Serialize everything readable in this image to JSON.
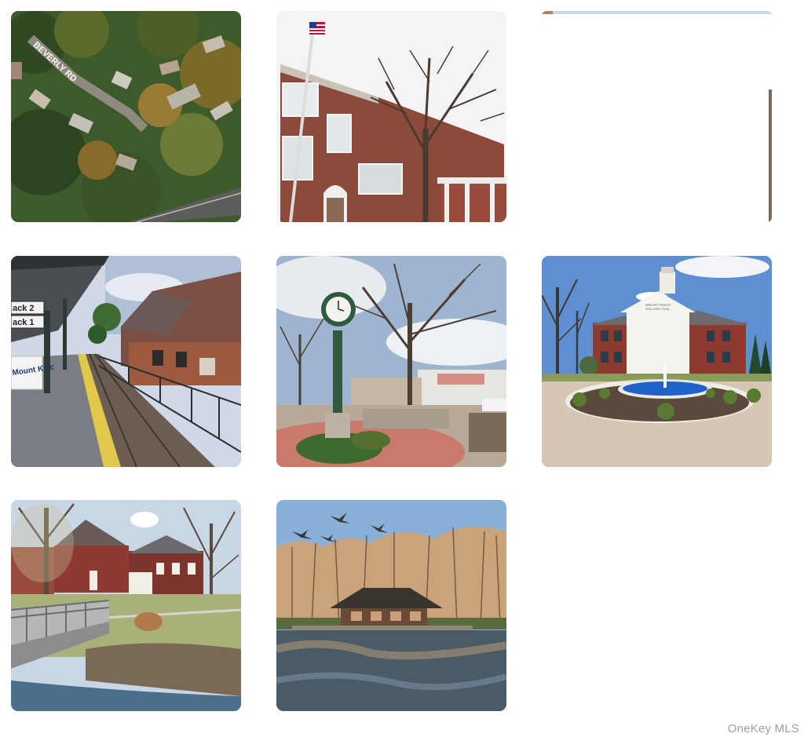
{
  "photos": [
    {
      "scene": "aerial-neighborhood",
      "street_label": "BEVERLY RD"
    },
    {
      "scene": "brick-school-with-flag"
    },
    {
      "scene": "blank-loading"
    },
    {
      "scene": "train-station-platform",
      "sign_lines": [
        "ack 2",
        "ack 1"
      ],
      "station_sign": "Mount Kisc"
    },
    {
      "scene": "town-clock-plaza"
    },
    {
      "scene": "village-hall-fountain",
      "building_sign_lines": [
        "MOUNT KISCO",
        "VILLAGE HALL"
      ]
    },
    {
      "scene": "brick-buildings-footbridge"
    },
    {
      "scene": "pond-pavilion-geese"
    }
  ],
  "watermark": "OneKey MLS"
}
